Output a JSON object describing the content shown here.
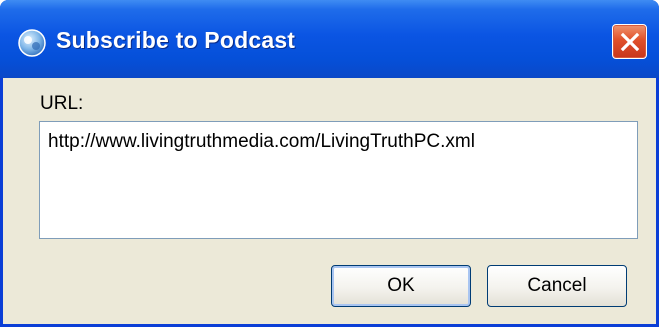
{
  "window": {
    "title": "Subscribe to Podcast",
    "title_icon": "podcast-globe-icon",
    "close_icon": "close-icon"
  },
  "form": {
    "url_label": "URL:",
    "url_value": "http://www.livingtruthmedia.com/LivingTruthPC.xml"
  },
  "buttons": {
    "ok_label": "OK",
    "cancel_label": "Cancel"
  },
  "colors": {
    "titlebar": "#0b55e3",
    "close_button": "#e0502a",
    "dialog_background": "#ece9d8",
    "field_border": "#7f9db9"
  }
}
